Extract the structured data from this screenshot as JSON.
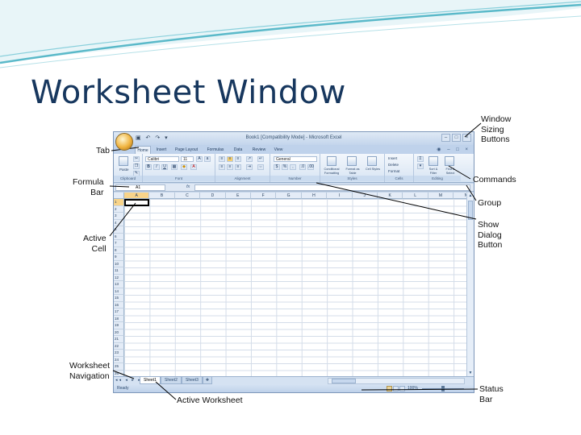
{
  "slide": {
    "title": "Worksheet Window"
  },
  "excel": {
    "window_title": "Book1 [Compatibility Mode] - Microsoft Excel",
    "window_controls": [
      "–",
      "□",
      "×"
    ],
    "qat": "▣ ↶ ↷ ▾",
    "tabs": [
      "Home",
      "Insert",
      "Page Layout",
      "Formulas",
      "Data",
      "Review",
      "View"
    ],
    "help_icons": "◉ – □ ×",
    "ribbon_groups": [
      "Clipboard",
      "Font",
      "Alignment",
      "Number",
      "Styles",
      "Cells",
      "Editing"
    ],
    "font_name": "Calibri",
    "font_size": "11",
    "number_format": "General",
    "paste_label": "Paste",
    "styles_buttons": [
      "Conditional Formatting",
      "Format as Table",
      "Cell Styles"
    ],
    "cells_buttons": [
      "Insert",
      "Delete",
      "Format"
    ],
    "editing_buttons": [
      "Sort & Filter",
      "Find & Select"
    ],
    "name_box": "A1",
    "fx": "fx",
    "columns": [
      "A",
      "B",
      "C",
      "D",
      "E",
      "F",
      "G",
      "H",
      "I",
      "J",
      "K",
      "L",
      "M",
      "N",
      "O"
    ],
    "rows": [
      "1",
      "2",
      "3",
      "4",
      "5",
      "6",
      "7",
      "8",
      "9",
      "10",
      "11",
      "12",
      "13",
      "14",
      "15",
      "16",
      "17",
      "18",
      "19",
      "20",
      "21",
      "22",
      "23",
      "24",
      "25",
      "26"
    ],
    "sheet_nav": "◂◂ ◂ ▸ ▸▸",
    "sheets": [
      "Sheet1",
      "Sheet2",
      "Sheet3"
    ],
    "status": "Ready",
    "zoom": "100%"
  },
  "callouts": {
    "tab": "Tab",
    "formula_bar": "Formula\nBar",
    "active_cell": "Active\nCell",
    "worksheet_navigation": "Worksheet\nNavigation",
    "active_worksheet": "Active Worksheet",
    "window_sizing": "Window\nSizing\nButtons",
    "commands": "Commands",
    "group": "Group",
    "show_dialog": "Show\nDialog\nButton",
    "status_bar": "Status\nBar"
  },
  "colors": {
    "title": "#17375e",
    "window_frame": "#c5d6ea",
    "active_header": "#f8d48a",
    "swoosh": "#4fb8c9"
  }
}
